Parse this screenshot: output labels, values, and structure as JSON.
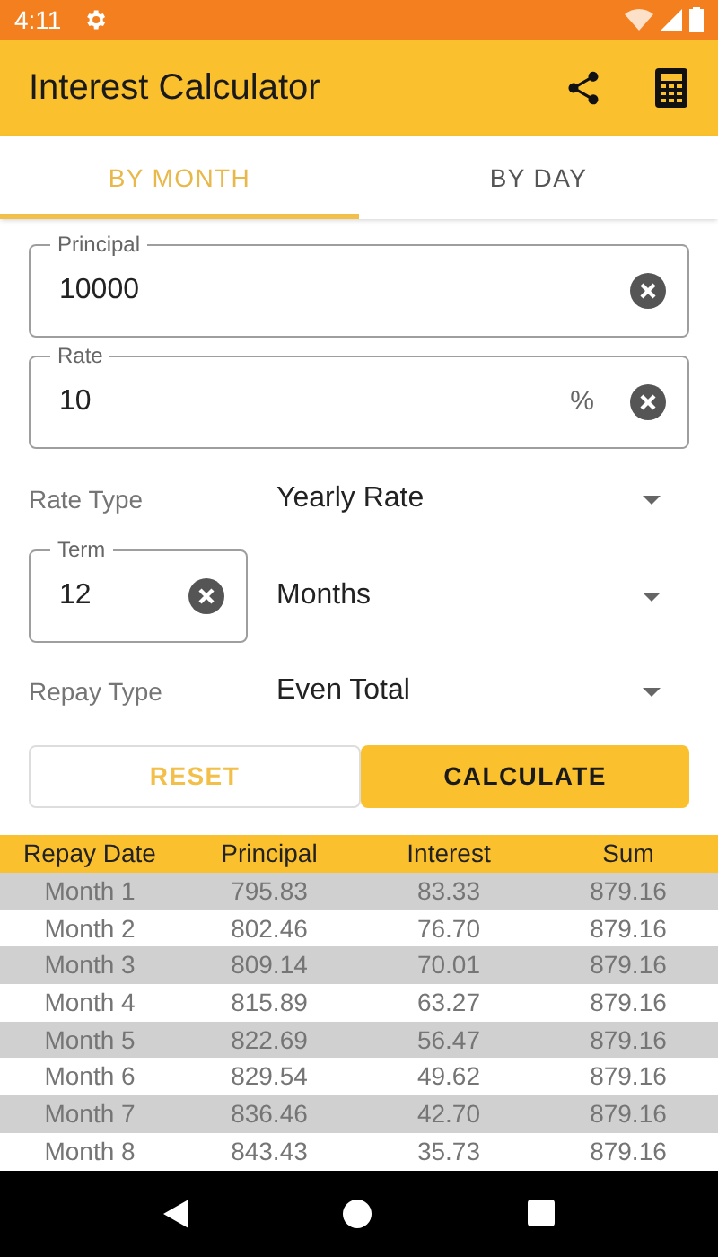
{
  "status_bar": {
    "time": "4:11"
  },
  "app_bar": {
    "title": "Interest Calculator"
  },
  "tabs": [
    {
      "label": "BY MONTH",
      "selected": true
    },
    {
      "label": "BY DAY",
      "selected": false
    }
  ],
  "principal": {
    "label": "Principal",
    "value": "10000"
  },
  "rate": {
    "label": "Rate",
    "value": "10",
    "suffix": "%"
  },
  "rate_type": {
    "label": "Rate Type",
    "value": "Yearly Rate"
  },
  "term": {
    "label": "Term",
    "value": "12",
    "unit": "Months"
  },
  "repay_type": {
    "label": "Repay Type",
    "value": "Even Total"
  },
  "buttons": [
    {
      "label": "RESET",
      "kind": "outline"
    },
    {
      "label": "CALCULATE",
      "kind": "filled"
    }
  ],
  "table": {
    "columns": [
      "Repay Date",
      "Principal",
      "Interest",
      "Sum"
    ],
    "rows": [
      [
        "Month 1",
        "795.83",
        "83.33",
        "879.16"
      ],
      [
        "Month 2",
        "802.46",
        "76.70",
        "879.16"
      ],
      [
        "Month 3",
        "809.14",
        "70.01",
        "879.16"
      ],
      [
        "Month 4",
        "815.89",
        "63.27",
        "879.16"
      ],
      [
        "Month 5",
        "822.69",
        "56.47",
        "879.16"
      ],
      [
        "Month 6",
        "829.54",
        "49.62",
        "879.16"
      ],
      [
        "Month 7",
        "836.46",
        "42.70",
        "879.16"
      ],
      [
        "Month 8",
        "843.43",
        "35.73",
        "879.16"
      ]
    ]
  }
}
